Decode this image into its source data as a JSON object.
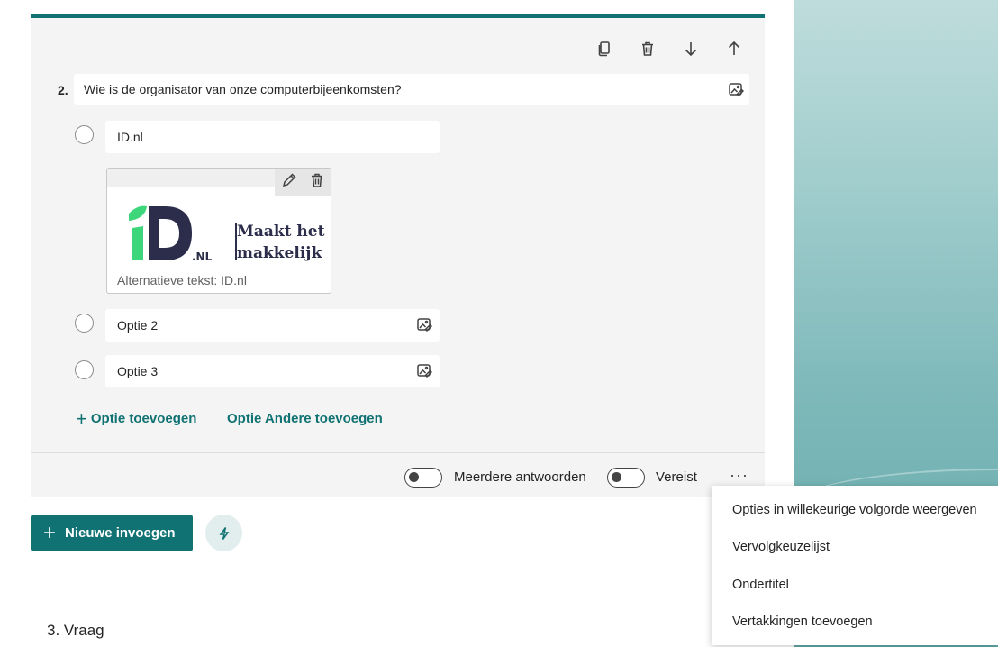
{
  "question": {
    "number": "2.",
    "title": "Wie is de organisator van onze computerbijeenkomsten?",
    "options": [
      {
        "label": "ID.nl"
      },
      {
        "label": "Optie 2"
      },
      {
        "label": "Optie 3"
      }
    ],
    "image": {
      "logo_line1": "Maakt het",
      "logo_line2": "makkelijk",
      "logo_suffix": ".NL",
      "alt_text": "Alternatieve tekst: ID.nl"
    },
    "add_option": "Optie toevoegen",
    "add_other": "Optie Andere toevoegen",
    "footer": {
      "multiple_answers": "Meerdere antwoorden",
      "required": "Vereist",
      "more": "···"
    }
  },
  "actions": {
    "new_insert": "Nieuwe invoegen"
  },
  "next_question": "3. Vraag",
  "menu": {
    "items": [
      "Opties in willekeurige volgorde weergeven",
      "Vervolgkeuzelijst",
      "Ondertitel",
      "Vertakkingen toevoegen"
    ]
  },
  "colors": {
    "accent": "#107272",
    "logo_green": "#3dd67a",
    "logo_navy": "#2b2d4a"
  },
  "icons": [
    "copy-icon",
    "delete-icon",
    "move-down-icon",
    "move-up-icon",
    "image-insert-icon",
    "edit-icon",
    "bolt-icon"
  ]
}
